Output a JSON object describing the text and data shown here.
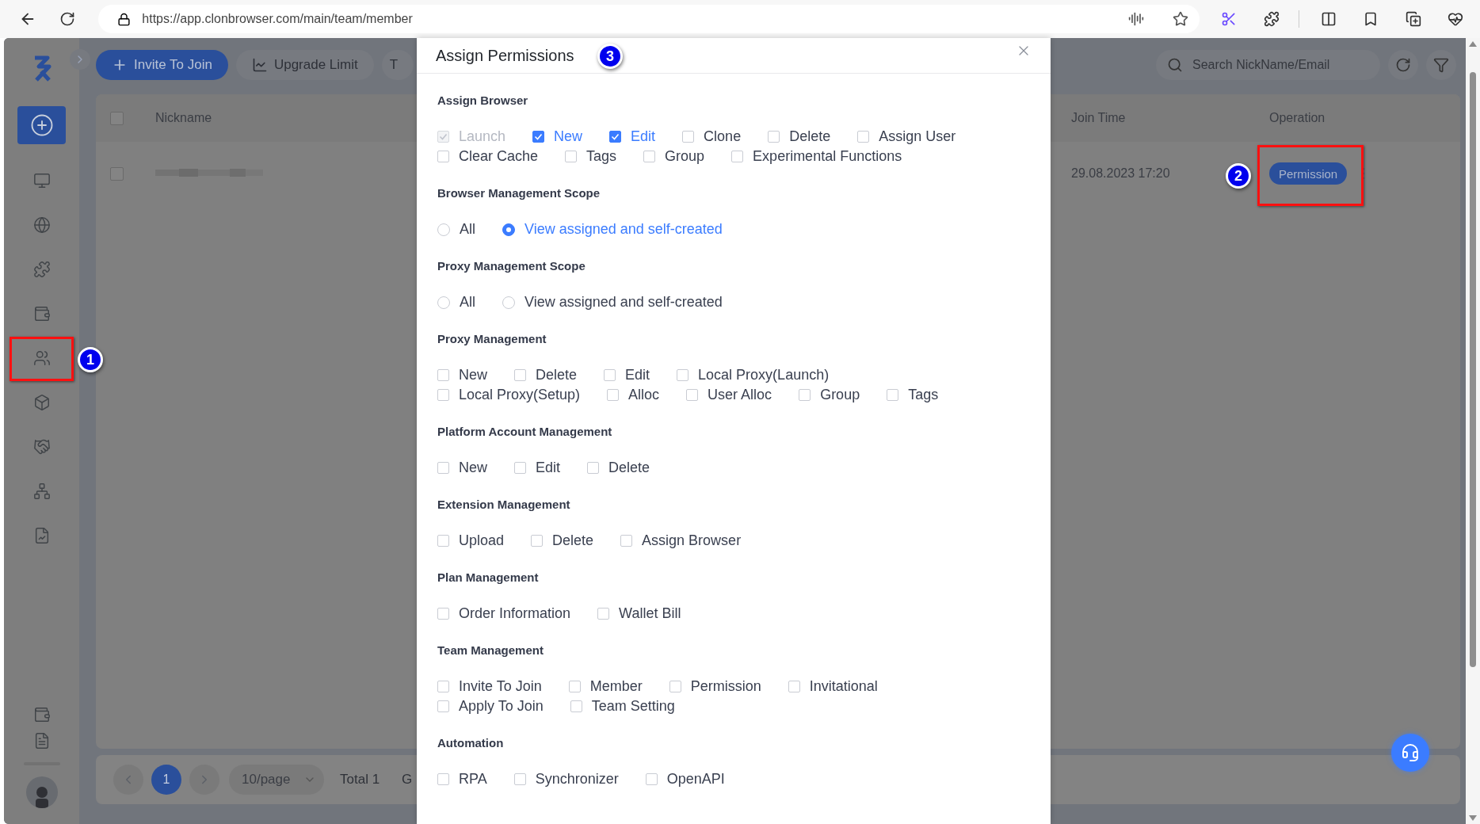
{
  "browser": {
    "url": "https://app.clonbrowser.com/main/team/member"
  },
  "toolbar": {
    "buttons": [
      {
        "label": "Invite To Join",
        "kind": "primary"
      },
      {
        "label": "Upgrade Limit",
        "kind": "default"
      },
      {
        "label": "T",
        "kind": "default"
      }
    ]
  },
  "search": {
    "placeholder": "Search NickName/Email"
  },
  "table": {
    "columns": [
      "Nickname",
      "Join Time",
      "Operation"
    ],
    "all_checked": false,
    "rows": [
      {
        "checked": false,
        "join_time": "29.08.2023 17:20",
        "action": "Permission"
      }
    ]
  },
  "pagination": {
    "pages": [
      {
        "label": "1",
        "selected": true
      }
    ],
    "page_size": "10/page",
    "total": "Total 1",
    "trailing_text": "G"
  },
  "modal": {
    "title": "Assign Permissions",
    "sections": [
      {
        "title": "Assign Browser",
        "kind": "checkbox",
        "options": [
          {
            "label": "Launch",
            "checked": true,
            "disabled": true
          },
          {
            "label": "New",
            "checked": true,
            "disabled": false
          },
          {
            "label": "Edit",
            "checked": true,
            "disabled": false
          },
          {
            "label": "Clone",
            "checked": false,
            "disabled": false
          },
          {
            "label": "Delete",
            "checked": false,
            "disabled": false
          },
          {
            "label": "Assign User",
            "checked": false,
            "disabled": false
          },
          {
            "label": "Clear Cache",
            "checked": false,
            "disabled": false
          },
          {
            "label": "Tags",
            "checked": false,
            "disabled": false
          },
          {
            "label": "Group",
            "checked": false,
            "disabled": false
          },
          {
            "label": "Experimental Functions",
            "checked": false,
            "disabled": false
          }
        ]
      },
      {
        "title": "Browser Management Scope",
        "kind": "radio",
        "options": [
          {
            "label": "All",
            "selected": false
          },
          {
            "label": "View assigned and self-created",
            "selected": true
          }
        ]
      },
      {
        "title": "Proxy Management Scope",
        "kind": "radio",
        "options": [
          {
            "label": "All",
            "selected": false
          },
          {
            "label": "View assigned and self-created",
            "selected": false
          }
        ]
      },
      {
        "title": "Proxy Management",
        "kind": "checkbox",
        "options": [
          {
            "label": "New",
            "checked": false,
            "disabled": false
          },
          {
            "label": "Delete",
            "checked": false,
            "disabled": false
          },
          {
            "label": "Edit",
            "checked": false,
            "disabled": false
          },
          {
            "label": "Local Proxy(Launch)",
            "checked": false,
            "disabled": false
          },
          {
            "label": "Local Proxy(Setup)",
            "checked": false,
            "disabled": false
          },
          {
            "label": "Alloc",
            "checked": false,
            "disabled": false
          },
          {
            "label": "User Alloc",
            "checked": false,
            "disabled": false
          },
          {
            "label": "Group",
            "checked": false,
            "disabled": false
          },
          {
            "label": "Tags",
            "checked": false,
            "disabled": false
          }
        ]
      },
      {
        "title": "Platform Account Management",
        "kind": "checkbox",
        "options": [
          {
            "label": "New",
            "checked": false,
            "disabled": false
          },
          {
            "label": "Edit",
            "checked": false,
            "disabled": false
          },
          {
            "label": "Delete",
            "checked": false,
            "disabled": false
          }
        ]
      },
      {
        "title": "Extension Management",
        "kind": "checkbox",
        "options": [
          {
            "label": "Upload",
            "checked": false,
            "disabled": false
          },
          {
            "label": "Delete",
            "checked": false,
            "disabled": false
          },
          {
            "label": "Assign Browser",
            "checked": false,
            "disabled": false
          }
        ]
      },
      {
        "title": "Plan Management",
        "kind": "checkbox",
        "options": [
          {
            "label": "Order Information",
            "checked": false,
            "disabled": false
          },
          {
            "label": "Wallet Bill",
            "checked": false,
            "disabled": false
          }
        ]
      },
      {
        "title": "Team Management",
        "kind": "checkbox",
        "options": [
          {
            "label": "Invite To Join",
            "checked": false,
            "disabled": false
          },
          {
            "label": "Member",
            "checked": false,
            "disabled": false
          },
          {
            "label": "Permission",
            "checked": false,
            "disabled": false
          },
          {
            "label": "Invitational",
            "checked": false,
            "disabled": false
          },
          {
            "label": "Apply To Join",
            "checked": false,
            "disabled": false
          },
          {
            "label": "Team Setting",
            "checked": false,
            "disabled": false
          }
        ]
      },
      {
        "title": "Automation",
        "kind": "checkbox",
        "options": [
          {
            "label": "RPA",
            "checked": false,
            "disabled": false
          },
          {
            "label": "Synchronizer",
            "checked": false,
            "disabled": false
          },
          {
            "label": "OpenAPI",
            "checked": false,
            "disabled": false
          }
        ]
      }
    ]
  },
  "annotations": [
    {
      "label": "1"
    },
    {
      "label": "2"
    },
    {
      "label": "3"
    }
  ]
}
